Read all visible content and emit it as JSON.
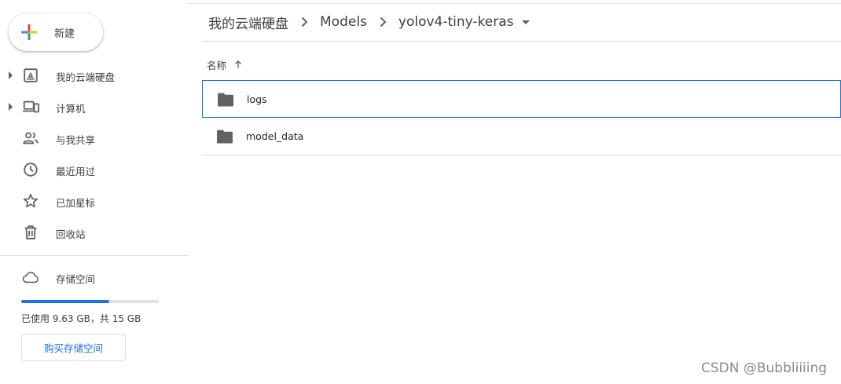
{
  "sidebar": {
    "new_label": "新建",
    "items": [
      {
        "label": "我的云端硬盘",
        "icon": "drive-icon",
        "expandable": true
      },
      {
        "label": "计算机",
        "icon": "computers-icon",
        "expandable": true
      },
      {
        "label": "与我共享",
        "icon": "shared-people-icon",
        "expandable": false
      },
      {
        "label": "最近用过",
        "icon": "clock-icon",
        "expandable": false
      },
      {
        "label": "已加星标",
        "icon": "star-icon",
        "expandable": false
      },
      {
        "label": "回收站",
        "icon": "trash-icon",
        "expandable": false
      }
    ],
    "storage": {
      "label": "存储空间",
      "icon": "cloud-icon",
      "usage_text": "已使用 9.63 GB，共 15 GB",
      "used_fraction": 0.642,
      "buy_label": "购买存储空间"
    }
  },
  "breadcrumb": {
    "items": [
      "我的云端硬盘",
      "Models"
    ],
    "current": "yolov4-tiny-keras"
  },
  "file_list": {
    "column_name": "名称",
    "sort": "ascending",
    "rows": [
      {
        "name": "logs",
        "type": "folder",
        "selected": true
      },
      {
        "name": "model_data",
        "type": "folder",
        "selected": false
      }
    ]
  },
  "watermark": "CSDN @Bubbliiiing",
  "colors": {
    "accent": "#1a73e8",
    "text": "#3c4043",
    "icon": "#5f6368",
    "divider": "#dadce0"
  }
}
